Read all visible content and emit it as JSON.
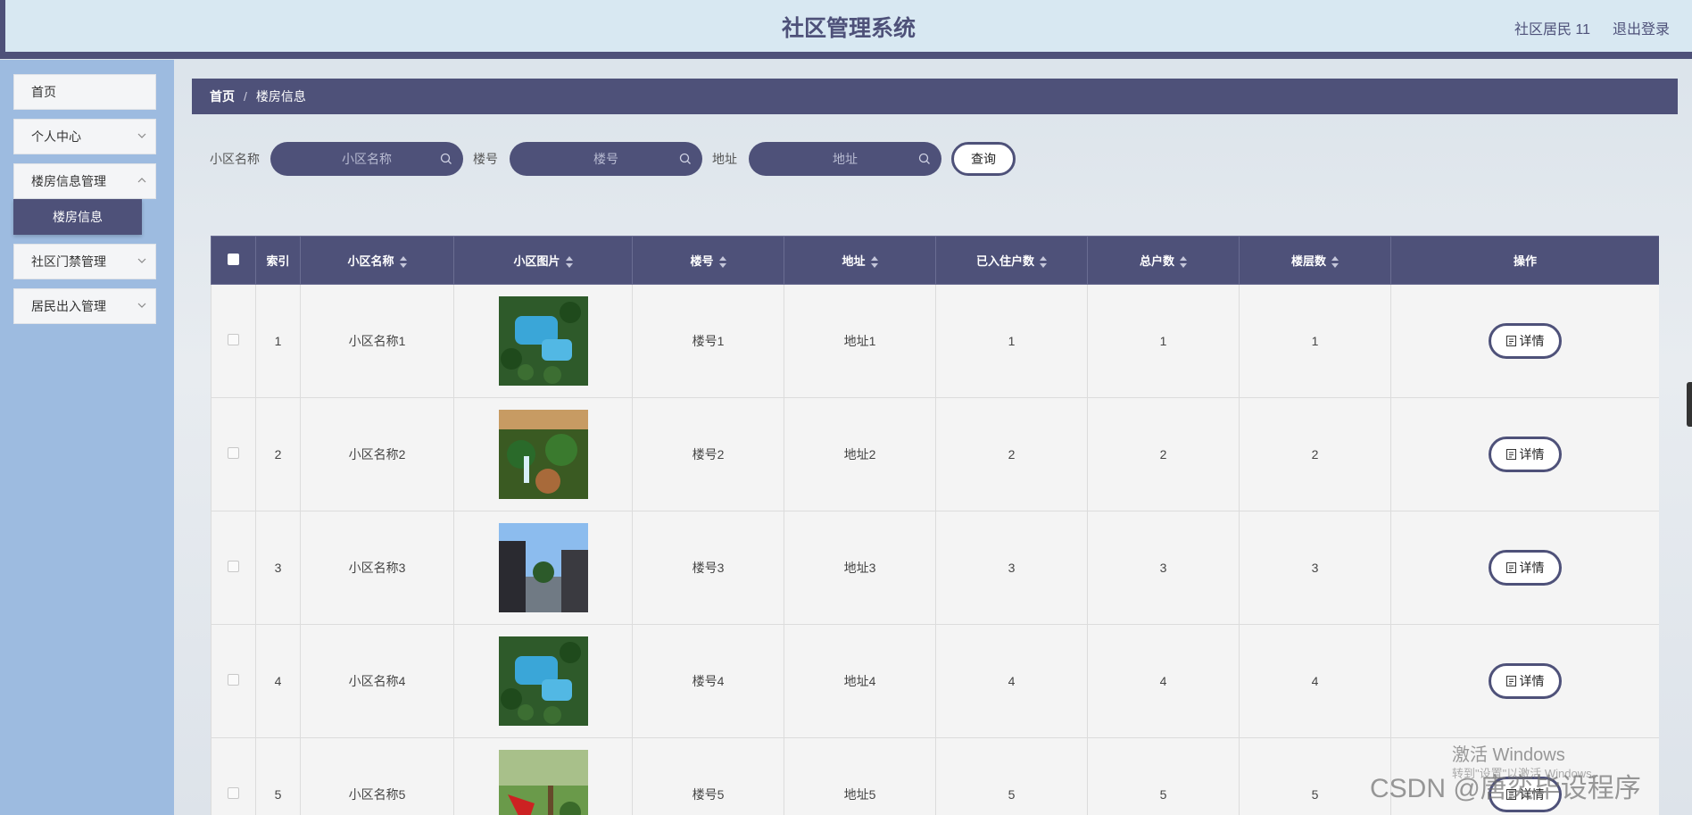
{
  "header": {
    "title": "社区管理系统",
    "user": "社区居民 11",
    "logout": "退出登录"
  },
  "sidebar": {
    "items": [
      {
        "label": "首页"
      },
      {
        "label": "个人中心"
      },
      {
        "label": "楼房信息管理"
      },
      {
        "label": "社区门禁管理"
      },
      {
        "label": "居民出入管理"
      }
    ],
    "active_sub": "楼房信息"
  },
  "breadcrumb": {
    "home": "首页",
    "sep": "/",
    "current": "楼房信息"
  },
  "search": {
    "community_label": "小区名称",
    "community_placeholder": "小区名称",
    "building_label": "楼号",
    "building_placeholder": "楼号",
    "address_label": "地址",
    "address_placeholder": "地址",
    "query_button": "查询"
  },
  "table": {
    "columns": [
      "索引",
      "小区名称",
      "小区图片",
      "楼号",
      "地址",
      "已入住户数",
      "总户数",
      "楼层数",
      "操作"
    ],
    "detail_label": "详情",
    "rows": [
      {
        "index": "1",
        "community": "小区名称1",
        "image": "pool",
        "building": "楼号1",
        "address": "地址1",
        "occupied": "1",
        "total": "1",
        "floors": "1"
      },
      {
        "index": "2",
        "community": "小区名称2",
        "image": "garden",
        "building": "楼号2",
        "address": "地址2",
        "occupied": "2",
        "total": "2",
        "floors": "2"
      },
      {
        "index": "3",
        "community": "小区名称3",
        "image": "street",
        "building": "楼号3",
        "address": "地址3",
        "occupied": "3",
        "total": "3",
        "floors": "3"
      },
      {
        "index": "4",
        "community": "小区名称4",
        "image": "pool",
        "building": "楼号4",
        "address": "地址4",
        "occupied": "4",
        "total": "4",
        "floors": "4"
      },
      {
        "index": "5",
        "community": "小区名称5",
        "image": "playground",
        "building": "楼号5",
        "address": "地址5",
        "occupied": "5",
        "total": "5",
        "floors": "5"
      }
    ]
  },
  "watermarks": {
    "windows_title": "激活 Windows",
    "windows_sub": "转到\"设置\"以激活 Windows。",
    "csdn": "CSDN @唐奕毕设程序"
  },
  "colors": {
    "primary": "#4e5179",
    "sidebar_bg": "#9dbbe0",
    "header_bg": "#d8e8f2"
  }
}
